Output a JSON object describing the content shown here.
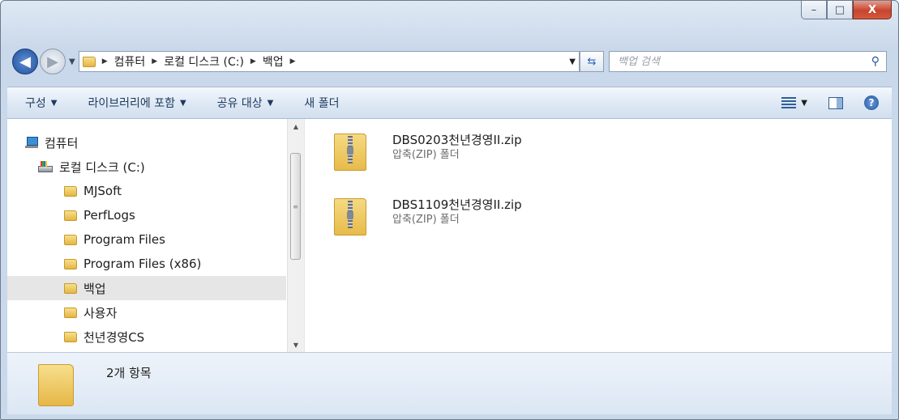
{
  "window": {
    "controls": {
      "minimize": "–",
      "maximize": "□",
      "close": "X"
    }
  },
  "address": {
    "back_icon": "◀",
    "forward_icon": "▶",
    "crumbs": [
      "컴퓨터",
      "로컬 디스크 (C:)",
      "백업"
    ],
    "refresh_icon": "⇆"
  },
  "search": {
    "placeholder": "백업 검색",
    "icon": "⚲"
  },
  "toolbar": {
    "organize": "구성",
    "include_library": "라이브러리에 포함",
    "share_with": "공유 대상",
    "new_folder": "새 폴더",
    "help": "?"
  },
  "nav": {
    "items": [
      {
        "label": "컴퓨터"
      },
      {
        "label": "로컬 디스크 (C:)"
      },
      {
        "label": "MJSoft"
      },
      {
        "label": "PerfLogs"
      },
      {
        "label": "Program Files"
      },
      {
        "label": "Program Files (x86)"
      },
      {
        "label": "백업"
      },
      {
        "label": "사용자"
      },
      {
        "label": "천년경영CS"
      }
    ]
  },
  "files": [
    {
      "name": "DBS0203천년경영II.zip",
      "type": "압축(ZIP) 폴더"
    },
    {
      "name": "DBS1109천년경영II.zip",
      "type": "압축(ZIP) 폴더"
    }
  ],
  "details": {
    "summary": "2개 항목"
  }
}
